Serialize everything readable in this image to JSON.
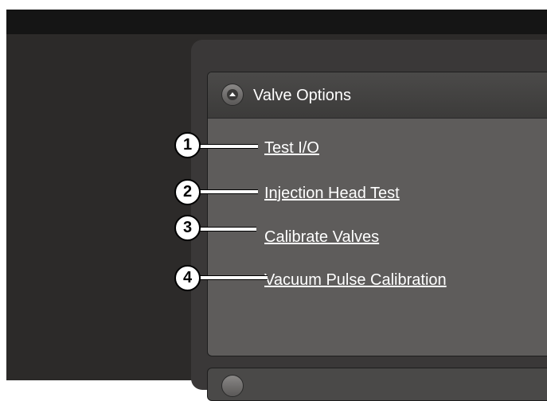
{
  "panel": {
    "title": "Valve Options",
    "links": [
      {
        "label": "Test I/O"
      },
      {
        "label": "Injection Head Test"
      },
      {
        "label": "Calibrate Valves"
      },
      {
        "label": "Vacuum Pulse Calibration"
      }
    ]
  },
  "callouts": [
    "1",
    "2",
    "3",
    "4"
  ],
  "icons": {
    "collapse": "chevron-up-icon"
  },
  "colors": {
    "window_background": "#2c2a29",
    "titlebar": "#151515",
    "panel_background": "#5e5c5b",
    "panel_header": "#444342",
    "link_text": "#ffffff"
  }
}
